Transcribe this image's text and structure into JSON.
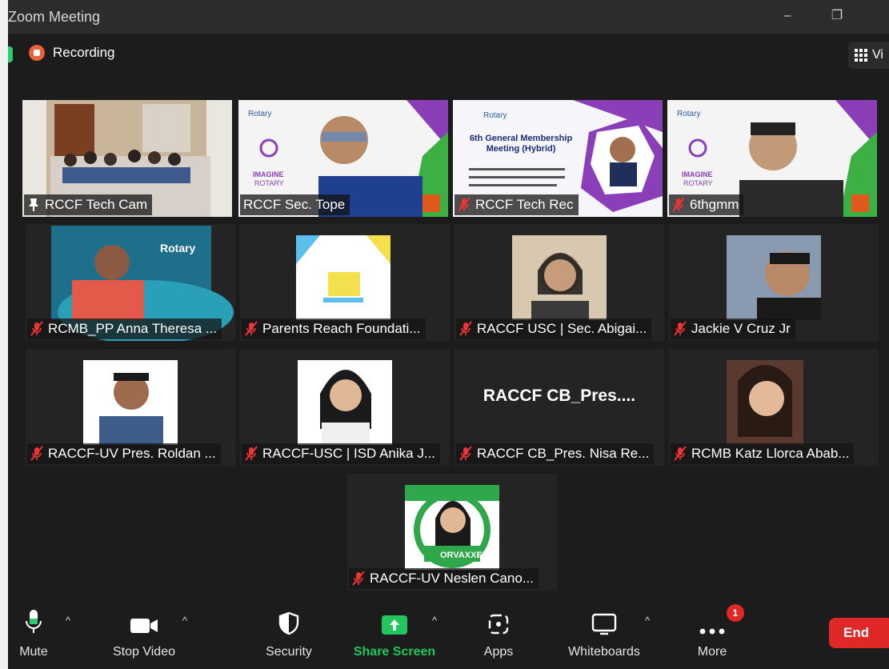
{
  "window": {
    "title": "Zoom Meeting",
    "minimize": "–",
    "restore": "❐"
  },
  "recording": {
    "label": "Recording"
  },
  "view_button": {
    "label": "Vi"
  },
  "participants": [
    {
      "name": "RCCF Tech Cam",
      "muted": false,
      "pinned": true
    },
    {
      "name": "RCCF Sec. Tope",
      "muted": false,
      "pinned": false
    },
    {
      "name": "RCCF Tech Rec",
      "muted": true,
      "pinned": false
    },
    {
      "name": "6thgmm",
      "muted": true,
      "pinned": false
    },
    {
      "name": "RCMB_PP Anna Theresa ...",
      "muted": true,
      "pinned": false
    },
    {
      "name": "Parents Reach Foundati...",
      "muted": true,
      "pinned": false
    },
    {
      "name": "RACCF USC | Sec. Abigai...",
      "muted": true,
      "pinned": false
    },
    {
      "name": "Jackie V Cruz Jr",
      "muted": true,
      "pinned": false
    },
    {
      "name": "RACCF-UV Pres. Roldan ...",
      "muted": true,
      "pinned": false
    },
    {
      "name": "RACCF-USC | ISD Anika J...",
      "muted": true,
      "pinned": false
    },
    {
      "name": "RACCF CB_Pres. Nisa Re...",
      "muted": true,
      "pinned": false,
      "display": "RACCF  CB_Pres...."
    },
    {
      "name": "RCMB Katz Llorca Abab...",
      "muted": true,
      "pinned": false
    },
    {
      "name": "RACCF-UV Neslen Cano...",
      "muted": true,
      "pinned": false
    }
  ],
  "slides": {
    "rotary": "Rotary",
    "imagine": "IMAGINE",
    "rotary_word": "ROTARY",
    "gm_title": "6th General Membership Meeting (Hybrid)",
    "orvaxxed": "ORVAXXED"
  },
  "toolbar": {
    "mute": "Mute",
    "stop_video": "Stop Video",
    "security": "Security",
    "share_screen": "Share Screen",
    "apps": "Apps",
    "whiteboards": "Whiteboards",
    "more": "More",
    "more_badge": "1",
    "end": "End"
  },
  "colors": {
    "share_green": "#22c55e",
    "end_red": "#e02828",
    "active_border": "#e8e27a",
    "recording": "#e9623b"
  }
}
